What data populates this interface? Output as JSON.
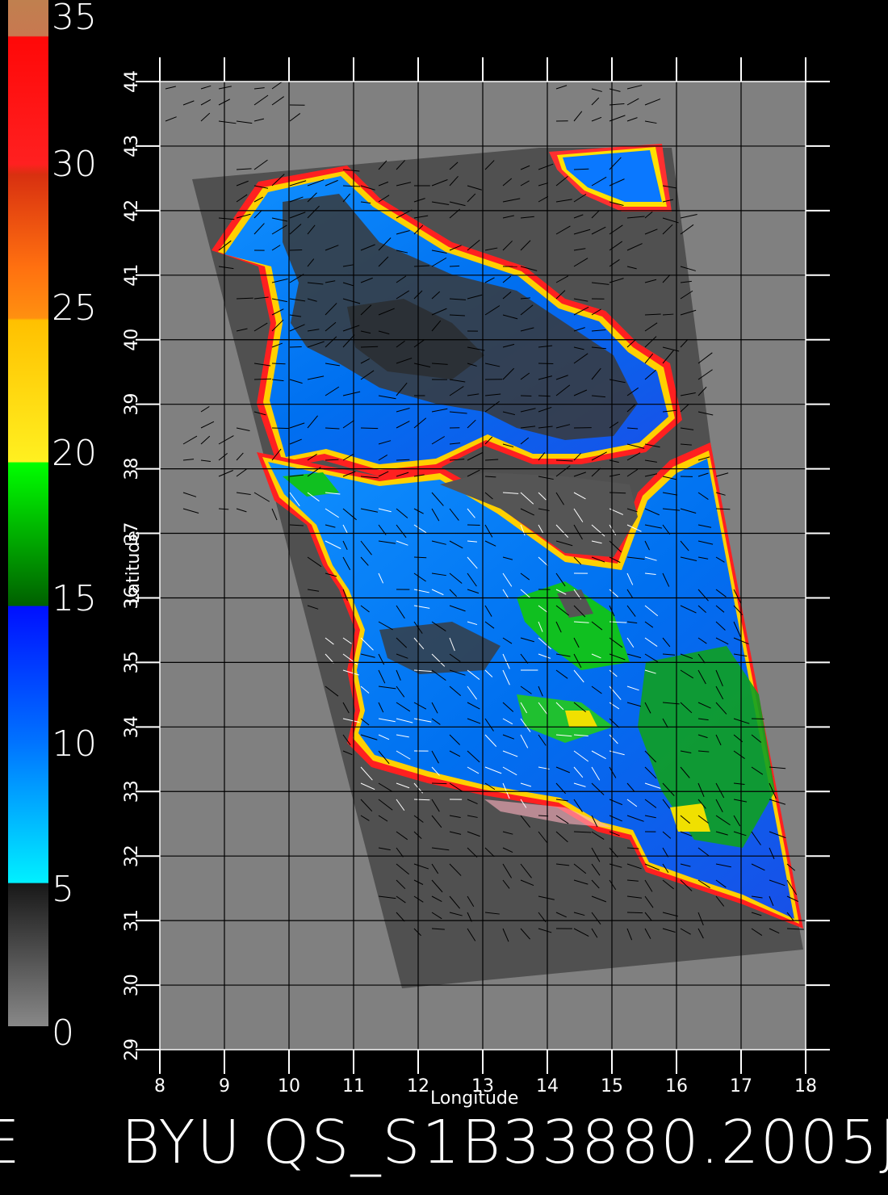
{
  "colorbar": {
    "labels": [
      "35",
      "30",
      "25",
      "20",
      "15",
      "10",
      "5",
      "0"
    ],
    "stops": [
      {
        "color": "#c87850"
      },
      {
        "color": "#ff1a1a"
      },
      {
        "color": "#dd3010"
      },
      {
        "color": "#ff9000"
      },
      {
        "color": "#ffd000"
      },
      {
        "color": "#00e000"
      },
      {
        "color": "#0040ff"
      },
      {
        "color": "#00a0ff"
      },
      {
        "color": "#00f0ff"
      },
      {
        "color": "#202020"
      },
      {
        "color": "#808080"
      }
    ]
  },
  "map": {
    "xlabel": "Longitude",
    "ylabel": "Latitude",
    "lon_ticks": [
      "8",
      "9",
      "10",
      "11",
      "12",
      "13",
      "14",
      "15",
      "16",
      "17",
      "18"
    ],
    "lat_ticks": [
      "29",
      "30",
      "31",
      "32",
      "33",
      "34",
      "35",
      "36",
      "37",
      "38",
      "39",
      "40",
      "41",
      "42",
      "43",
      "44"
    ],
    "lon_range": [
      8,
      18
    ],
    "lat_range": [
      29,
      44
    ],
    "background_color": "#808080",
    "swath_color": "#505050",
    "land_color": "#4a4a4a"
  },
  "footer": {
    "left_fragment": "E",
    "text": "BYU  QS_S1B33880.2005J"
  }
}
